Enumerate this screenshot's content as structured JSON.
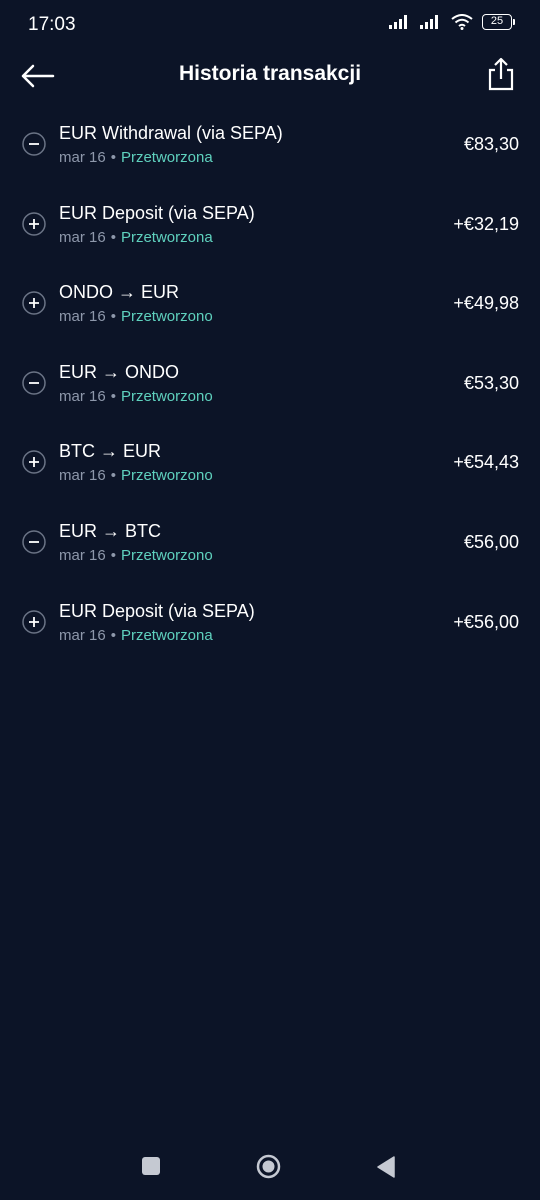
{
  "status_bar": {
    "time": "17:03",
    "battery": "25",
    "icons": [
      "signal-icon",
      "signal-icon",
      "wifi-icon",
      "battery-icon"
    ]
  },
  "header": {
    "title": "Historia transakcji",
    "back_icon": "arrow-left-icon",
    "share_icon": "share-icon"
  },
  "colors": {
    "background": "#0c1427",
    "status_text": "#5fd1be",
    "secondary_text": "#8e98ab"
  },
  "transactions": [
    {
      "type": "minus",
      "title": "EUR Withdrawal (via SEPA)",
      "date": "mar 16",
      "status": "Przetworzona",
      "amount": "€83,30"
    },
    {
      "type": "plus",
      "title": "EUR Deposit (via SEPA)",
      "date": "mar 16",
      "status": "Przetworzona",
      "amount": "+€32,19"
    },
    {
      "type": "plus",
      "title": "ONDO → EUR",
      "date": "mar 16",
      "status": "Przetworzono",
      "amount": "+€49,98"
    },
    {
      "type": "minus",
      "title": "EUR → ONDO",
      "date": "mar 16",
      "status": "Przetworzono",
      "amount": "€53,30"
    },
    {
      "type": "plus",
      "title": "BTC → EUR",
      "date": "mar 16",
      "status": "Przetworzono",
      "amount": "+€54,43"
    },
    {
      "type": "minus",
      "title": "EUR → BTC",
      "date": "mar 16",
      "status": "Przetworzono",
      "amount": "€56,00"
    },
    {
      "type": "plus",
      "title": "EUR Deposit (via SEPA)",
      "date": "mar 16",
      "status": "Przetworzona",
      "amount": "+€56,00"
    }
  ],
  "separator": "•",
  "nav": {
    "recents_icon": "square-icon",
    "home_icon": "circle-icon",
    "back_icon": "triangle-back-icon"
  }
}
